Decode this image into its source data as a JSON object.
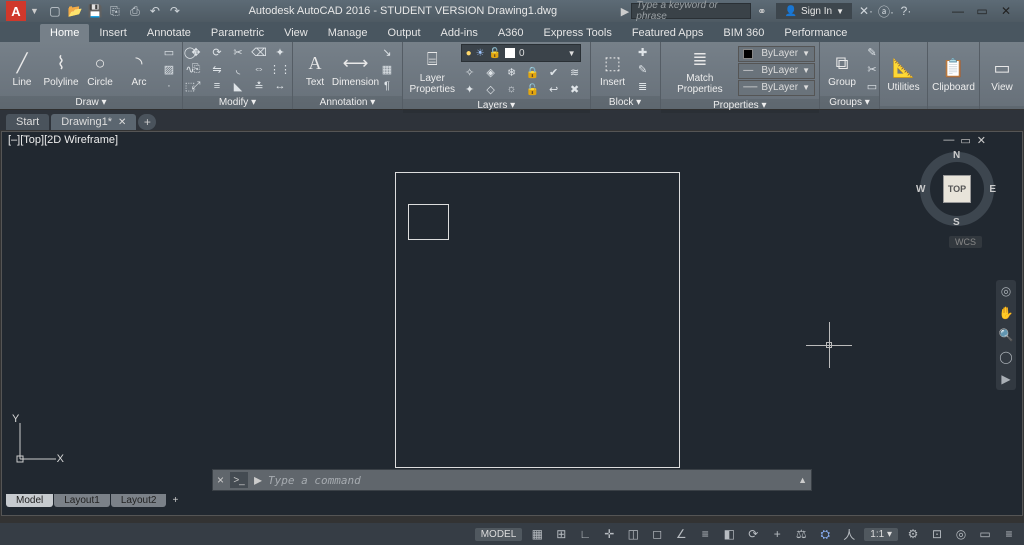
{
  "qat": {
    "app_letter": "A",
    "title": "Autodesk AutoCAD 2016 - STUDENT VERSION   Drawing1.dwg",
    "search_placeholder": "Type a keyword or phrase",
    "signin": "Sign In",
    "icons": [
      "new",
      "open",
      "save",
      "saveas",
      "plot",
      "undo",
      "redo"
    ]
  },
  "window_controls": {
    "min": "—",
    "max": "▭",
    "close": "✕"
  },
  "ribbon_tabs": [
    "Home",
    "Insert",
    "Annotate",
    "Parametric",
    "View",
    "Manage",
    "Output",
    "Add-ins",
    "A360",
    "Express Tools",
    "Featured Apps",
    "BIM 360",
    "Performance"
  ],
  "active_ribbon_tab": "Home",
  "panels": {
    "draw": {
      "label": "Draw ▾",
      "items": [
        {
          "name": "Line",
          "icon": "╱"
        },
        {
          "name": "Polyline",
          "icon": "⌇"
        },
        {
          "name": "Circle",
          "icon": "○"
        },
        {
          "name": "Arc",
          "icon": "◝"
        }
      ]
    },
    "modify": {
      "label": "Modify ▾"
    },
    "annotation": {
      "label": "Annotation ▾",
      "items": [
        {
          "name": "Text",
          "icon": "A"
        },
        {
          "name": "Dimension",
          "icon": "⊢⊣"
        }
      ]
    },
    "layers": {
      "label": "Layers ▾",
      "layer_combo": "0",
      "big": {
        "name": "Layer Properties",
        "icon": "⌸"
      }
    },
    "block": {
      "label": "Block ▾",
      "big": {
        "name": "Insert",
        "icon": "⬚"
      }
    },
    "properties": {
      "label": "Properties ▾",
      "big": {
        "name": "Match Properties",
        "icon": "≣"
      },
      "rows": [
        "ByLayer",
        "ByLayer",
        "ByLayer"
      ]
    },
    "groups": {
      "label": "Groups ▾",
      "big": {
        "name": "Group",
        "icon": "⧉"
      }
    },
    "utilities": {
      "label": "Utilities",
      "big": {
        "name": "Utilities",
        "icon": "📐"
      }
    },
    "clipboard": {
      "label": "Clipboard",
      "big": {
        "name": "Clipboard",
        "icon": "📋"
      }
    },
    "view": {
      "label": "View",
      "big": {
        "name": "View",
        "icon": "▭"
      }
    }
  },
  "doc_tabs": {
    "start": "Start",
    "current": "Drawing1*"
  },
  "viewport": {
    "label": "[–][Top][2D Wireframe]",
    "controls": {
      "min": "—",
      "max": "▭",
      "close": "✕"
    }
  },
  "viewcube": {
    "face": "TOP",
    "n": "N",
    "s": "S",
    "e": "E",
    "w": "W",
    "wcs": "WCS"
  },
  "ucs": {
    "y": "Y",
    "x": "X"
  },
  "command_line": {
    "close": "×",
    "prompt": "Type a command",
    "chev": ">_"
  },
  "layout_tabs": [
    "Model",
    "Layout1",
    "Layout2"
  ],
  "status": {
    "model": "MODEL",
    "scale": "1:1"
  }
}
